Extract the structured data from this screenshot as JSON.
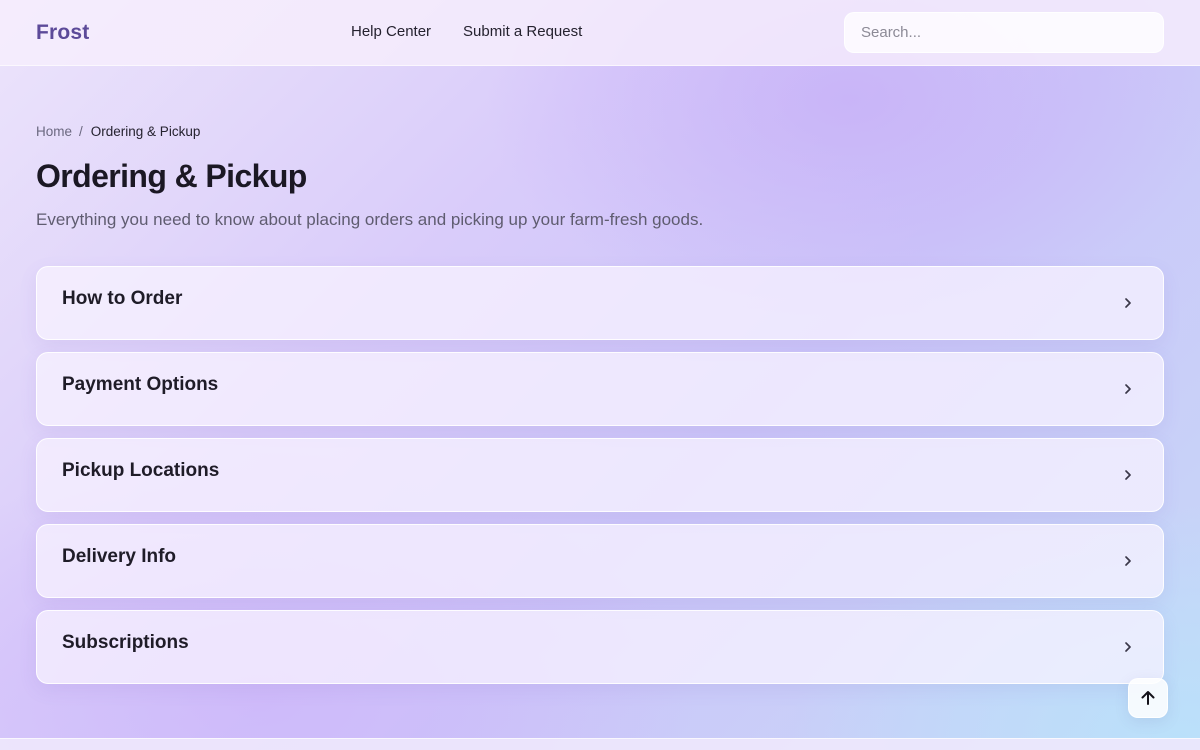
{
  "header": {
    "logo": "Frost",
    "nav": [
      {
        "label": "Help Center"
      },
      {
        "label": "Submit a Request"
      }
    ],
    "search": {
      "placeholder": "Search...",
      "value": ""
    }
  },
  "breadcrumb": {
    "home": "Home",
    "separator": "/",
    "current": "Ordering & Pickup"
  },
  "page": {
    "title": "Ordering & Pickup",
    "subtitle": "Everything you need to know about placing orders and picking up your farm-fresh goods."
  },
  "faq": {
    "items": [
      {
        "title": "How to Order",
        "icon": "chevron-right-icon"
      },
      {
        "title": "Payment Options",
        "icon": "chevron-right-icon"
      },
      {
        "title": "Pickup Locations",
        "icon": "chevron-right-icon"
      },
      {
        "title": "Delivery Info",
        "icon": "chevron-right-icon"
      },
      {
        "title": "Subscriptions",
        "icon": "chevron-right-icon"
      }
    ]
  },
  "back_to_top": {
    "icon": "arrow-up-icon"
  },
  "colors": {
    "brand": "#5c4a99",
    "text_primary": "#1b1824",
    "text_muted": "#5f5c70"
  }
}
